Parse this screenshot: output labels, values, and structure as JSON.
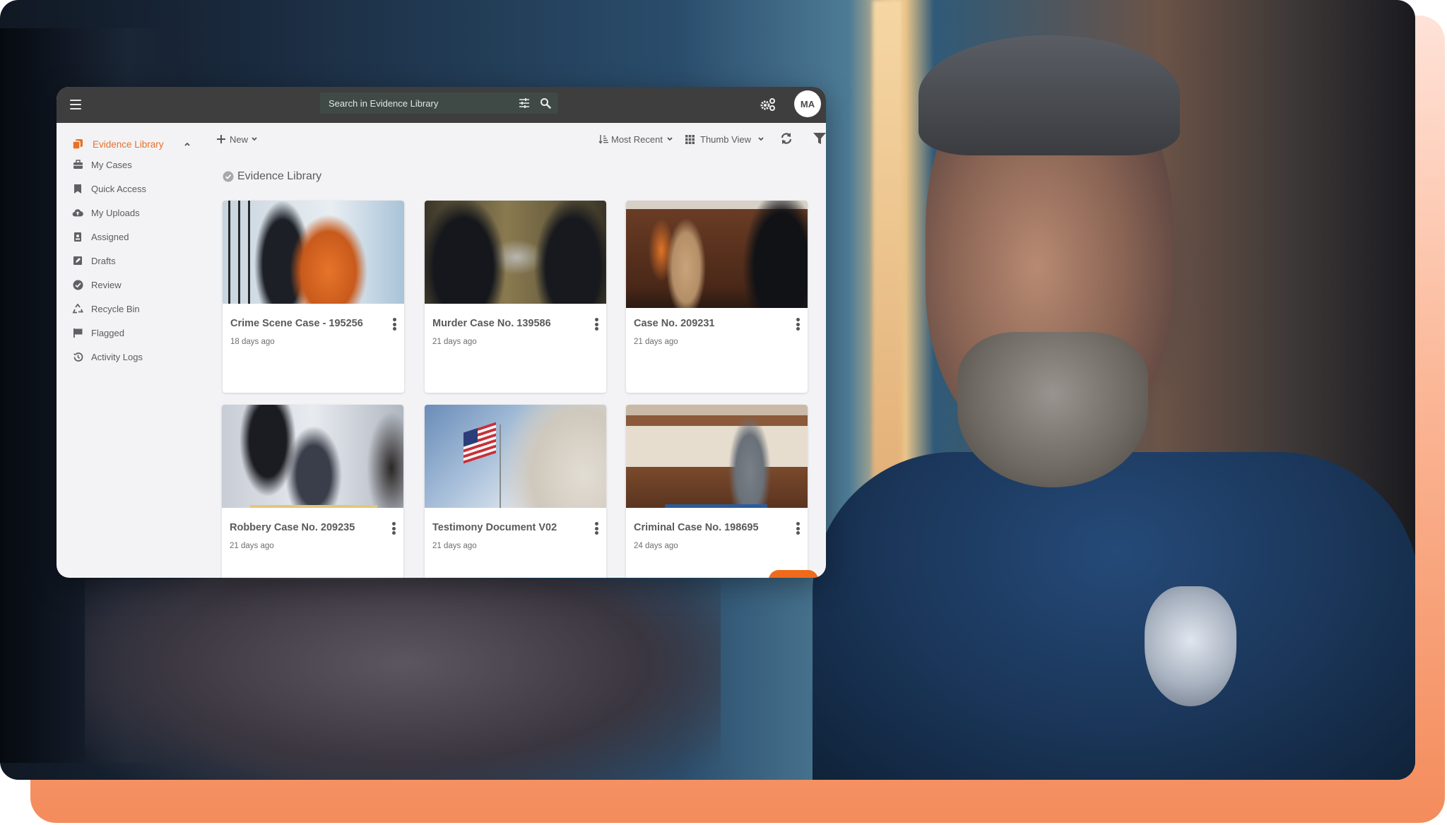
{
  "app": {
    "search": {
      "placeholder": "Search in Evidence Library"
    },
    "avatar_initials": "MA",
    "accent_color": "#e8702a"
  },
  "sidebar": {
    "items": [
      {
        "label": "Evidence Library",
        "icon": "library-icon",
        "active": true
      },
      {
        "label": "My Cases",
        "icon": "briefcase-icon"
      },
      {
        "label": "Quick Access",
        "icon": "bookmark-icon"
      },
      {
        "label": "My Uploads",
        "icon": "cloud-upload-icon"
      },
      {
        "label": "Assigned",
        "icon": "clipboard-user-icon"
      },
      {
        "label": "Drafts",
        "icon": "edit-icon"
      },
      {
        "label": "Review",
        "icon": "check-circle-icon"
      },
      {
        "label": "Recycle Bin",
        "icon": "recycle-icon"
      },
      {
        "label": "Flagged",
        "icon": "flag-icon"
      },
      {
        "label": "Activity Logs",
        "icon": "history-icon"
      }
    ]
  },
  "toolbar": {
    "new_label": "New",
    "sort_label": "Most Recent",
    "view_label": "Thumb View"
  },
  "main": {
    "section_title": "Evidence Library",
    "cards": [
      {
        "title": "Crime Scene Case - 195256",
        "date": "18 days ago"
      },
      {
        "title": "Murder Case No. 139586",
        "date": "21 days ago"
      },
      {
        "title": "Case No. 209231",
        "date": "21 days ago"
      },
      {
        "title": "Robbery Case No. 209235",
        "date": "21 days ago"
      },
      {
        "title": "Testimony Document V02",
        "date": "21 days ago"
      },
      {
        "title": "Criminal Case No. 198695",
        "date": "24 days ago"
      }
    ]
  }
}
